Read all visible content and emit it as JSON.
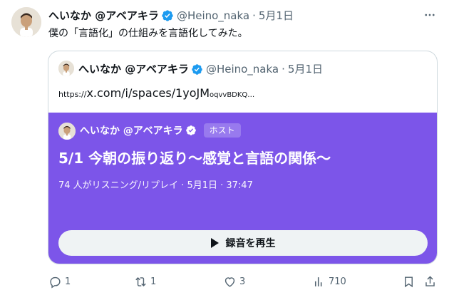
{
  "post": {
    "author_name": "へいなか @アベアキラ",
    "handle": "@Heino_naka",
    "separator": "·",
    "date": "5月1日",
    "text": "僕の「言語化」の仕組みを言語化してみた。"
  },
  "quote": {
    "author_name": "へいなか @アベアキラ",
    "handle": "@Heino_naka",
    "separator": "·",
    "date": "5月1日",
    "link_prefix": "https://",
    "link_main": "x.com/i/spaces/1yoJM",
    "link_tail": "oqvvBDKQ…"
  },
  "space": {
    "host_name": "へいなか @アベアキラ",
    "host_badge": "ホスト",
    "title": "5/1 今朝の振り返り〜感覚と言語の関係〜",
    "meta": "74 人がリスニング/リプレイ · 5月1日 · 37:47",
    "play_label": "録音を再生",
    "background_color": "#7c55e9"
  },
  "actions": {
    "reply_count": "1",
    "repost_count": "1",
    "like_count": "3",
    "views_count": "710"
  },
  "colors": {
    "verified": "#1d9bf0",
    "muted": "#536471"
  }
}
